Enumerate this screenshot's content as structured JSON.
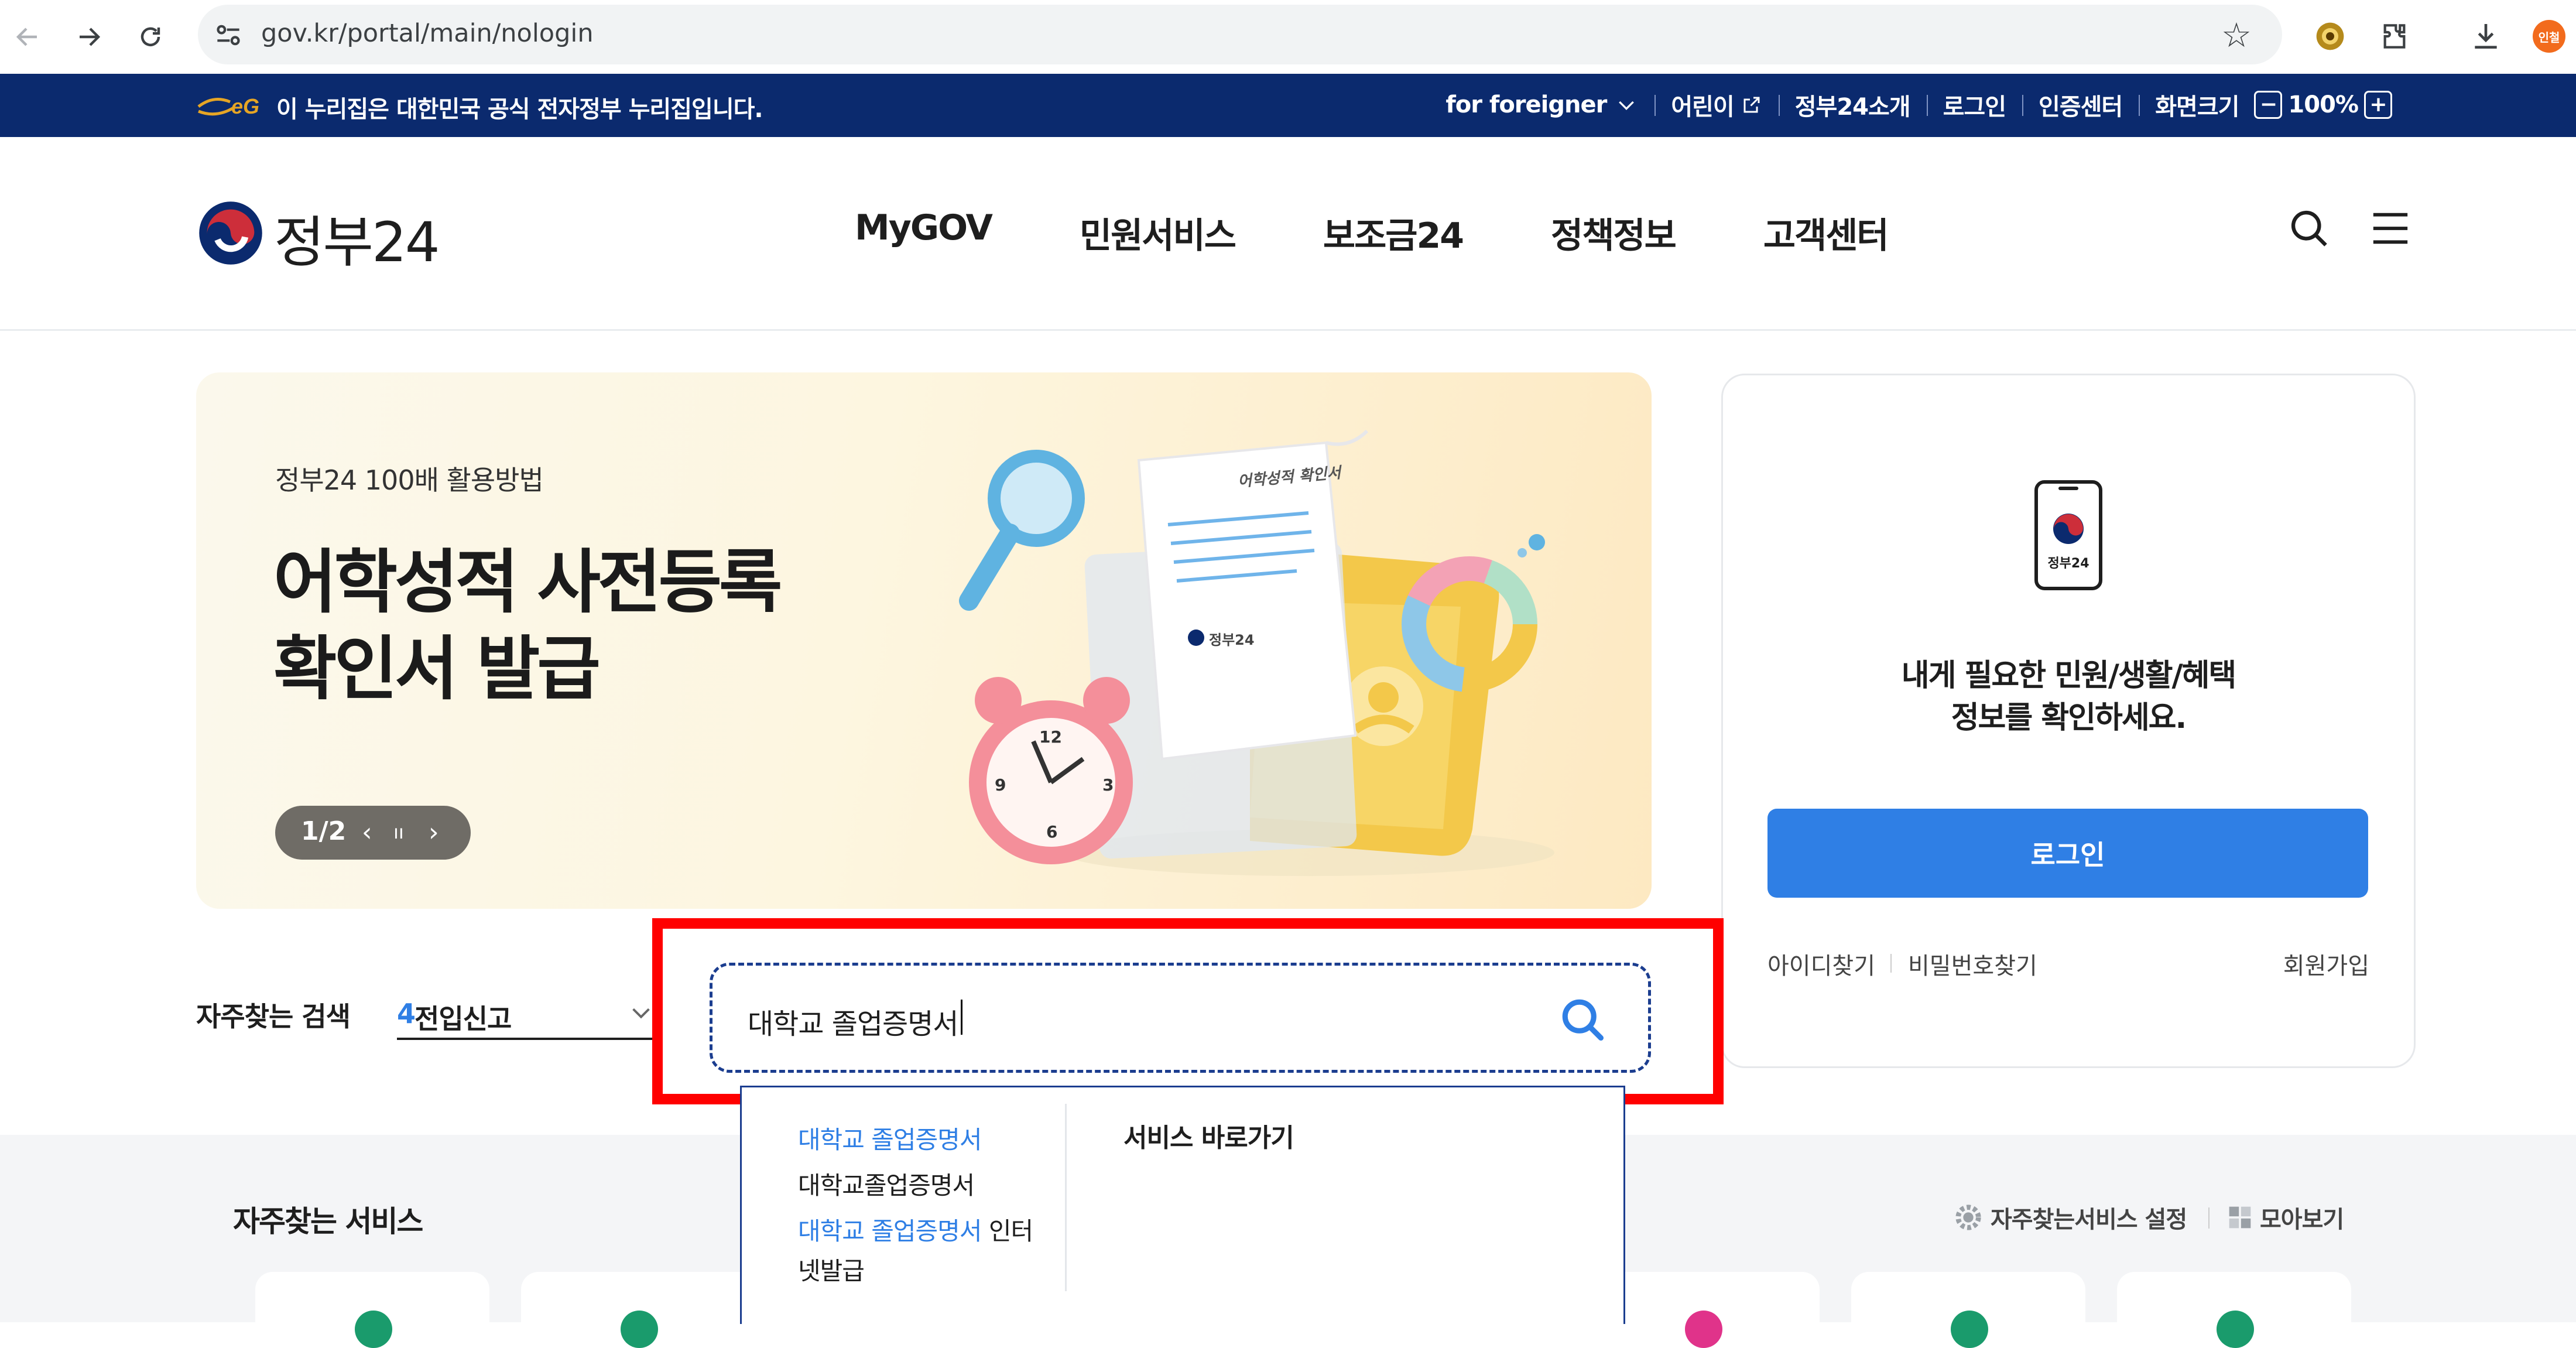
{
  "browser": {
    "url": "gov.kr/portal/main/nologin",
    "profile_badge": "인철"
  },
  "gov_strip": {
    "notice": "이 누리집은 대한민국 공식 전자정부 누리집입니다.",
    "links": {
      "foreigner": "for foreigner",
      "kids": "어린이",
      "about": "정부24소개",
      "login": "로그인",
      "cert": "인증센터",
      "screen_size": "화면크기",
      "zoom_minus": "−",
      "zoom_value": "100%",
      "zoom_plus": "+"
    }
  },
  "header": {
    "logo_text": "정부24",
    "nav": [
      "MyGOV",
      "민원서비스",
      "보조금24",
      "정책정보",
      "고객센터"
    ]
  },
  "hero": {
    "subtitle": "정부24 100배 활용방법",
    "title_line1": "어학성적 사전등록",
    "title_line2": "확인서 발급",
    "pager": "1/2",
    "illustration_doc_title": "어학성적 확인서",
    "illustration_logo": "정부24"
  },
  "login_card": {
    "phone_label": "정부24",
    "message_line1": "내게 필요한 민원/생활/혜택",
    "message_line2": "정보를 확인하세요.",
    "login_button": "로그인",
    "find_id": "아이디찾기",
    "find_password": "비밀번호찾기",
    "signup": "회원가입"
  },
  "frequent_search": {
    "label": "자주찾는 검색",
    "rank": "4",
    "term": "전입신고"
  },
  "search": {
    "value": "대학교 졸업증명서"
  },
  "autocomplete": {
    "items": [
      {
        "highlight": "대학교 졸업증명서",
        "rest": ""
      },
      {
        "highlight": "",
        "rest": "대학교졸업증명서"
      },
      {
        "highlight": "대학교 졸업증명서",
        "rest": " 인터"
      },
      {
        "highlight": "",
        "rest": "넷발급"
      }
    ],
    "service_title": "서비스 바로가기"
  },
  "services": {
    "title": "자주찾는 서비스",
    "settings": "자주찾는서비스 설정",
    "view_all": "모아보기"
  },
  "colors": {
    "gov_strip": "#0b2a6e",
    "accent_blue": "#2f7fe5",
    "annotation_red": "#ff0000"
  }
}
